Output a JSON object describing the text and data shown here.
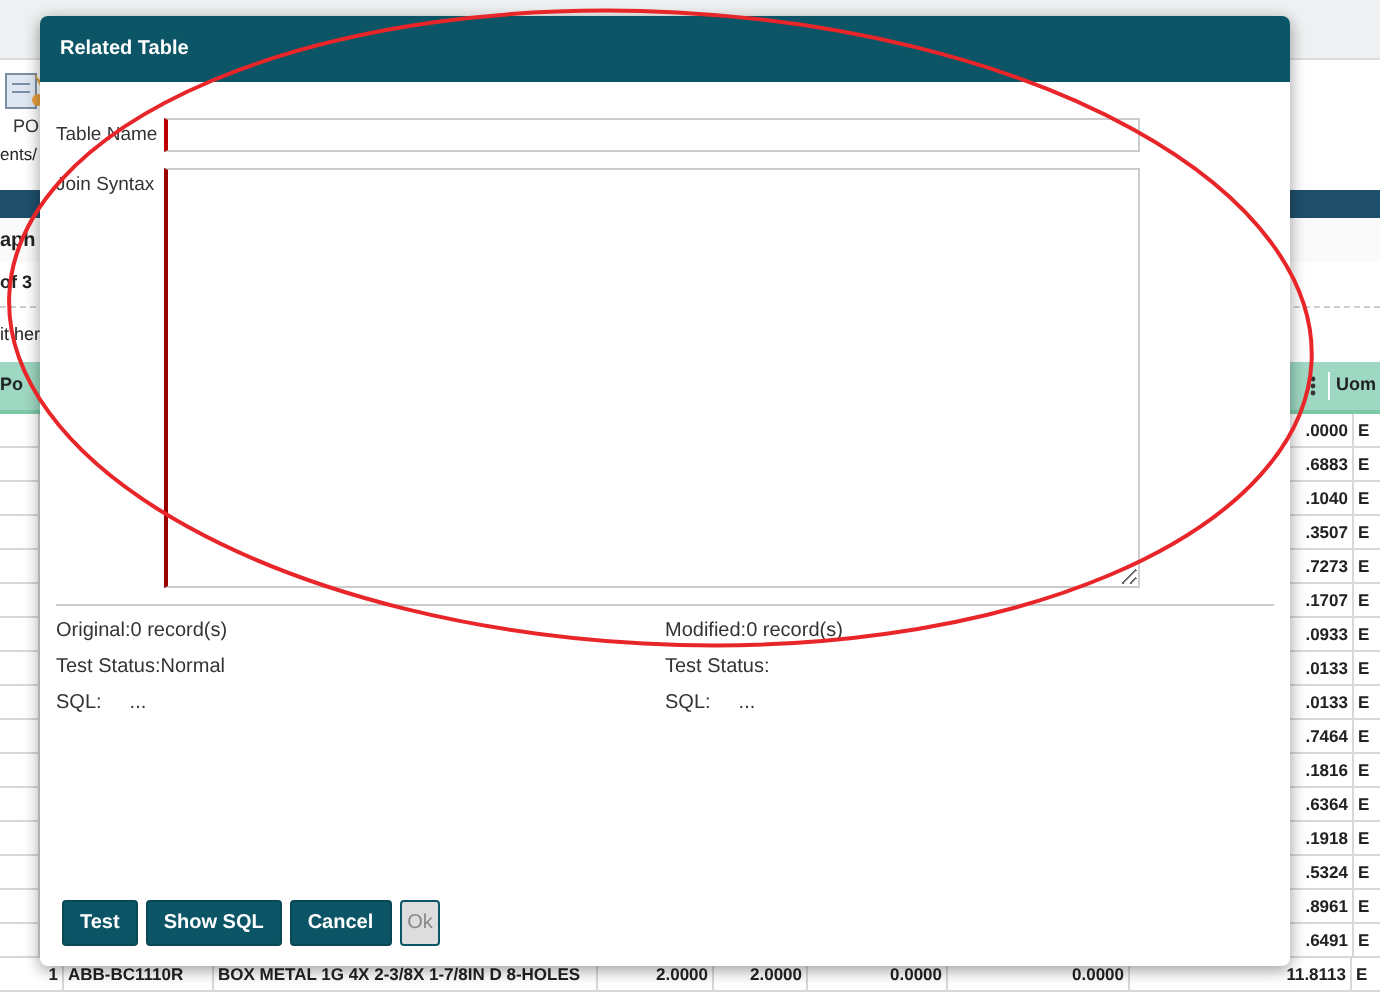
{
  "background": {
    "toolbar_button": {
      "label": "PO",
      "caption": "ents/"
    },
    "section_title": "aph",
    "pager": "of 3",
    "hint": "it her",
    "table": {
      "columns": [
        "Po",
        "Uom"
      ],
      "rows": [
        {
          "value": ".0000",
          "uom": "E"
        },
        {
          "value": ".6883",
          "uom": "E"
        },
        {
          "value": ".1040",
          "uom": "E"
        },
        {
          "value": ".3507",
          "uom": "E"
        },
        {
          "value": ".7273",
          "uom": "E"
        },
        {
          "value": ".1707",
          "uom": "E"
        },
        {
          "value": ".0933",
          "uom": "E"
        },
        {
          "value": ".0133",
          "uom": "E"
        },
        {
          "value": ".0133",
          "uom": "E"
        },
        {
          "value": ".7464",
          "uom": "E"
        },
        {
          "value": ".1816",
          "uom": "E"
        },
        {
          "value": ".6364",
          "uom": "E"
        },
        {
          "value": ".1918",
          "uom": "E"
        },
        {
          "value": ".5324",
          "uom": "E"
        },
        {
          "value": ".8961",
          "uom": "E"
        },
        {
          "value": ".6491",
          "uom": "E"
        }
      ],
      "last_row": [
        "1",
        "ABB-BC1110R",
        "BOX METAL 1G 4X 2-3/8X 1-7/8IN D 8-HOLES",
        "2.0000",
        "2.0000",
        "0.0000",
        "0.0000",
        "11.8113",
        "E"
      ]
    }
  },
  "dialog": {
    "title": "Related Table",
    "fields": [
      {
        "label": "Table Name",
        "kind": "input"
      },
      {
        "label": "Join Syntax",
        "kind": "textarea"
      }
    ],
    "status_columns": [
      {
        "lines": [
          {
            "text": "Original:0 record(s)"
          },
          {
            "text": "Test Status:Normal"
          },
          {
            "label": "SQL:",
            "value": "..."
          }
        ]
      },
      {
        "lines": [
          {
            "text": "Modified:0 record(s)"
          },
          {
            "text": "Test Status:"
          },
          {
            "label": "SQL:",
            "value": "..."
          }
        ]
      }
    ],
    "buttons": [
      {
        "label": "Test",
        "disabled": false
      },
      {
        "label": "Show SQL",
        "disabled": false
      },
      {
        "label": "Cancel",
        "disabled": false
      },
      {
        "label": "Ok",
        "disabled": true
      }
    ]
  }
}
